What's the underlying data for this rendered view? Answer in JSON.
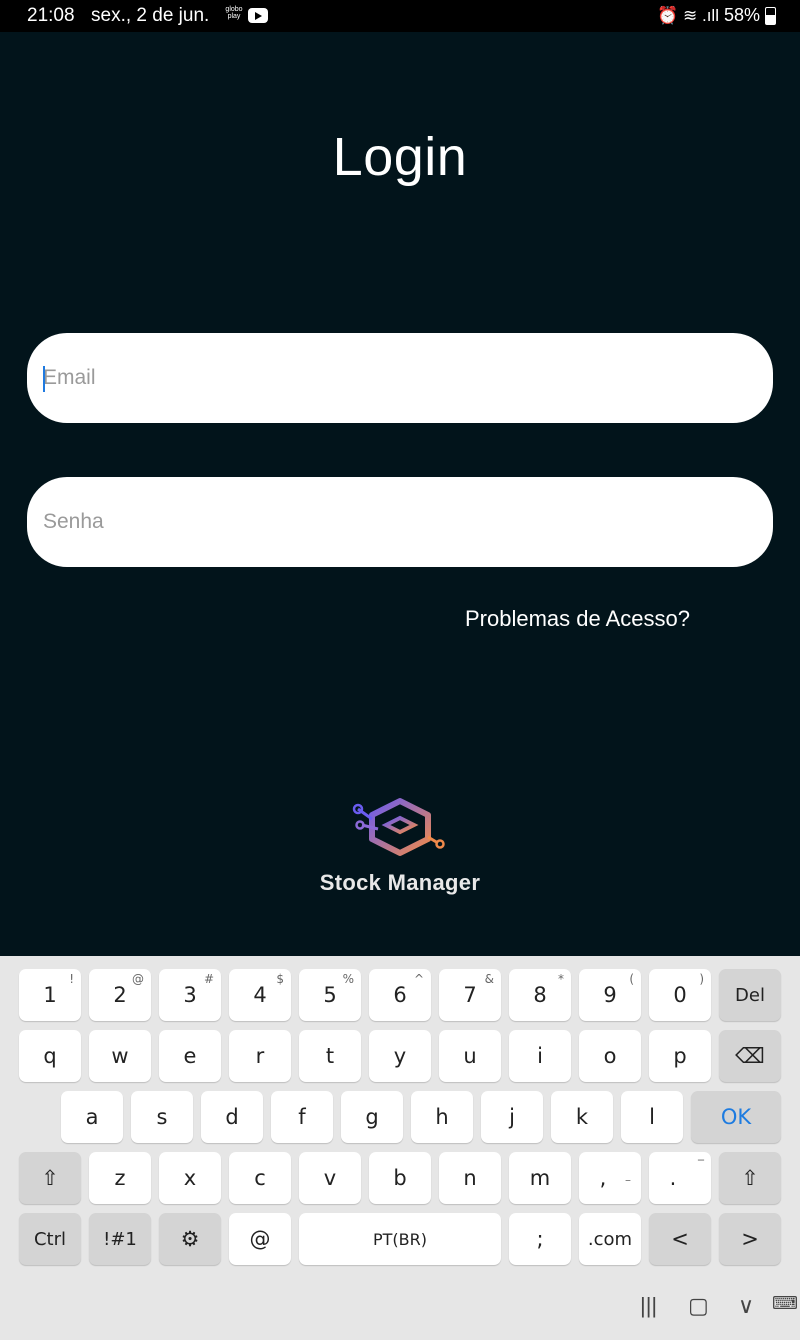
{
  "status_bar": {
    "time": "21:08",
    "date": "sex., 2 de jun.",
    "globo_label": "globo play",
    "signal_glyphs": "⏰ ≋ .ıll",
    "battery": "58%"
  },
  "page": {
    "title": "Login"
  },
  "form": {
    "email_placeholder": "Email",
    "password_placeholder": "Senha",
    "forgot_label": "Problemas de Acesso?"
  },
  "brand": {
    "name": "Stock Manager",
    "colors": [
      "#6a5cf0",
      "#f08a4b"
    ]
  },
  "keyboard": {
    "row1": [
      {
        "k": "1",
        "s": "!"
      },
      {
        "k": "2",
        "s": "@"
      },
      {
        "k": "3",
        "s": "#"
      },
      {
        "k": "4",
        "s": "$"
      },
      {
        "k": "5",
        "s": "%"
      },
      {
        "k": "6",
        "s": "^"
      },
      {
        "k": "7",
        "s": "&"
      },
      {
        "k": "8",
        "s": "*"
      },
      {
        "k": "9",
        "s": "("
      },
      {
        "k": "0",
        "s": ")"
      }
    ],
    "del": "Del",
    "row2": [
      "q",
      "w",
      "e",
      "r",
      "t",
      "y",
      "u",
      "i",
      "o",
      "p"
    ],
    "backspace_icon": "⌫",
    "row3": [
      "a",
      "s",
      "d",
      "f",
      "g",
      "h",
      "j",
      "k",
      "l"
    ],
    "ok": "OK",
    "shift_icon": "⇧",
    "row4": [
      "z",
      "x",
      "c",
      "v",
      "b",
      "n",
      "m"
    ],
    "comma": ",",
    "period": ".",
    "comma_alt": "–",
    "period_alt": "‾",
    "ctrl": "Ctrl",
    "symbols": "!#1",
    "settings_icon": "⚙",
    "at": "@",
    "space": "PT(BR)",
    "semicolon": ";",
    "dotcom": ".com",
    "left_icon": "<",
    "right_icon": ">"
  },
  "nav": {
    "recents": "|||",
    "home": "▢",
    "back": "∨",
    "keyboard": "⌨"
  }
}
